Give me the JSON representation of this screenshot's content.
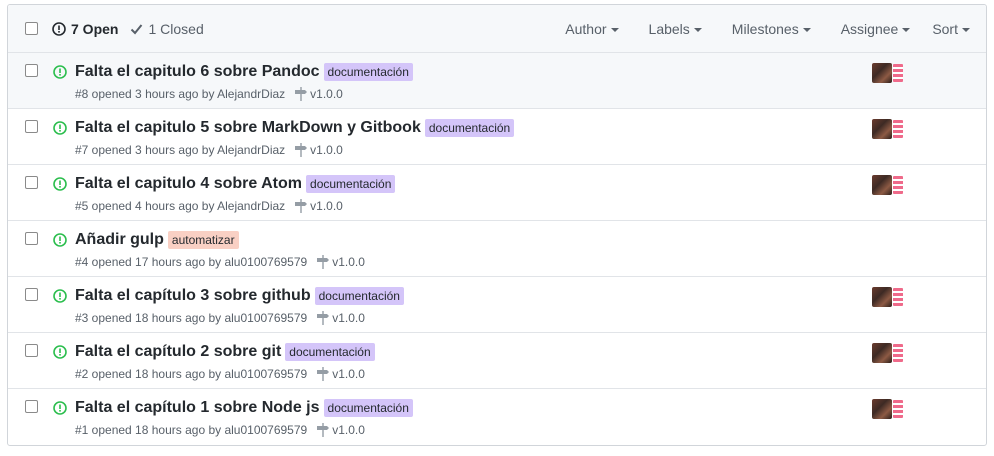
{
  "header": {
    "open_label": "7 Open",
    "closed_label": "1 Closed",
    "filters": [
      "Author",
      "Labels",
      "Milestones",
      "Assignee",
      "Sort"
    ]
  },
  "colors": {
    "open_icon": "#2cbe4e",
    "label_documentacion": "#d4c5f9",
    "label_automatizar": "#f9d0c4"
  },
  "issues": [
    {
      "title": "Falta el capitulo 6 sobre Pandoc",
      "label": "documentación",
      "meta": "#8 opened 3 hours ago by AlejandrDiaz",
      "milestone": "v1.0.0"
    },
    {
      "title": "Falta el capitulo 5 sobre MarkDown y Gitbook",
      "label": "documentación",
      "meta": "#7 opened 3 hours ago by AlejandrDiaz",
      "milestone": "v1.0.0"
    },
    {
      "title": "Falta el capitulo 4 sobre Atom",
      "label": "documentación",
      "meta": "#5 opened 4 hours ago by AlejandrDiaz",
      "milestone": "v1.0.0"
    },
    {
      "title": "Añadir gulp",
      "label": "automatizar",
      "meta": "#4 opened 17 hours ago by alu0100769579",
      "milestone": "v1.0.0"
    },
    {
      "title": "Falta el capítulo 3 sobre github",
      "label": "documentación",
      "meta": "#3 opened 18 hours ago by alu0100769579",
      "milestone": "v1.0.0"
    },
    {
      "title": "Falta el capítulo 2 sobre git",
      "label": "documentación",
      "meta": "#2 opened 18 hours ago by alu0100769579",
      "milestone": "v1.0.0"
    },
    {
      "title": "Falta el capítulo 1 sobre Node js",
      "label": "documentación",
      "meta": "#1 opened 18 hours ago by alu0100769579",
      "milestone": "v1.0.0"
    }
  ]
}
